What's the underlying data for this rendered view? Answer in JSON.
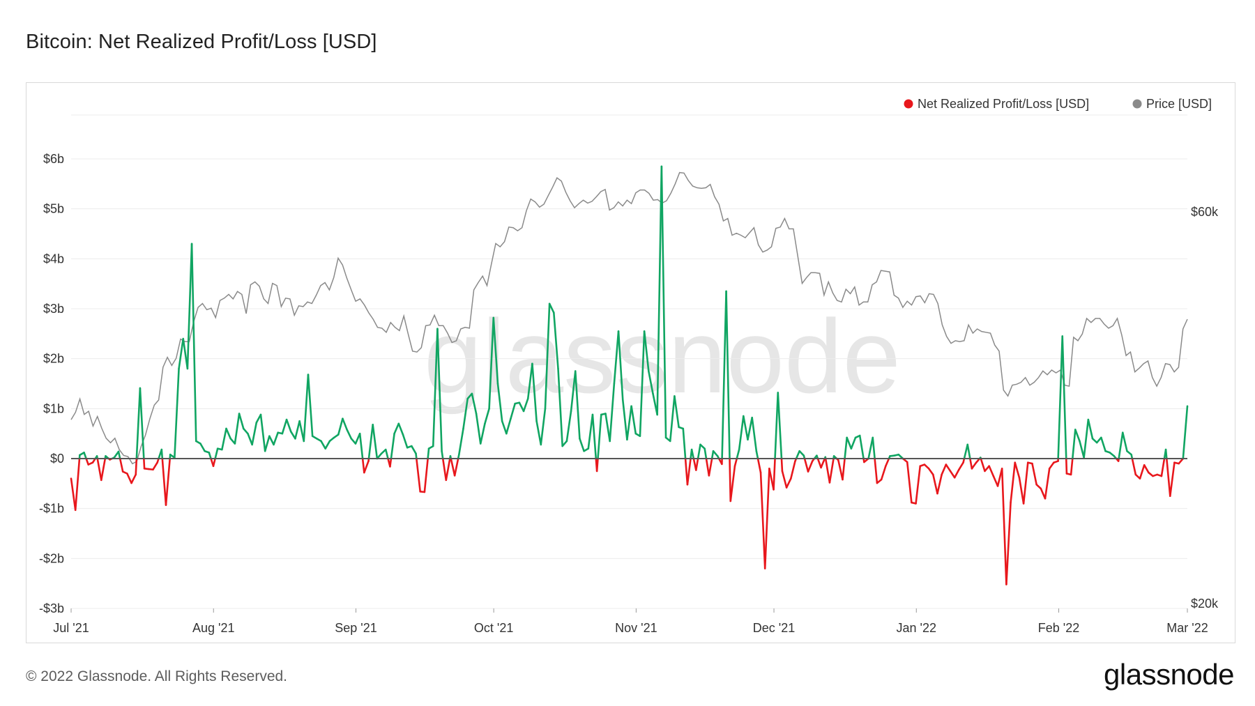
{
  "header": {
    "title": "Bitcoin: Net Realized Profit/Loss [USD]"
  },
  "footer": {
    "copyright": "© 2022 Glassnode. All Rights Reserved.",
    "brand": "glassnode"
  },
  "watermark": "glassnode",
  "colors": {
    "profit": "#10a562",
    "loss": "#e8171c",
    "price": "#8a8a8a",
    "zero": "#555555",
    "grid": "#ececec"
  },
  "chart_data": {
    "type": "line",
    "title": "Bitcoin: Net Realized Profit/Loss [USD]",
    "legend": {
      "placement": "top-right",
      "items": [
        {
          "label": "Net Realized Profit/Loss [USD]",
          "color": "#e8171c"
        },
        {
          "label": "Price [USD]",
          "color": "#8a8a8a"
        }
      ]
    },
    "x_ticks": [
      "Jul '21",
      "Aug '21",
      "Sep '21",
      "Oct '21",
      "Nov '21",
      "Dec '21",
      "Jan '22",
      "Feb '22",
      "Mar '22"
    ],
    "x_range": [
      "2021-07-01",
      "2022-03-01"
    ],
    "y_left": {
      "ticks": [
        "$6b",
        "$5b",
        "$4b",
        "$3b",
        "$2b",
        "$1b",
        "$0",
        "-$1b",
        "-$2b",
        "-$3b"
      ],
      "min": -3,
      "max": 6,
      "unit": "billion USD"
    },
    "y_right": {
      "ticks": [
        "$60k",
        "$20k"
      ],
      "min": 20000,
      "max": 60000,
      "scale": "log"
    },
    "grid": true,
    "series": [
      {
        "name": "Net Realized Profit/Loss [USD]",
        "unit": "billion USD",
        "values": [
          -0.4,
          -1.03,
          0.07,
          0.12,
          -0.12,
          -0.08,
          0.05,
          -0.43,
          0.05,
          -0.02,
          0.02,
          0.14,
          -0.26,
          -0.3,
          -0.49,
          -0.32,
          1.41,
          -0.2,
          -0.21,
          -0.22,
          -0.08,
          0.18,
          -0.93,
          0.08,
          0.02,
          1.8,
          2.4,
          1.8,
          4.3,
          0.35,
          0.3,
          0.15,
          0.12,
          -0.15,
          0.2,
          0.18,
          0.6,
          0.4,
          0.3,
          0.9,
          0.6,
          0.5,
          0.28,
          0.72,
          0.88,
          0.15,
          0.45,
          0.28,
          0.52,
          0.5,
          0.78,
          0.54,
          0.4,
          0.75,
          0.35,
          1.68,
          0.45,
          0.4,
          0.35,
          0.2,
          0.35,
          0.42,
          0.48,
          0.8,
          0.58,
          0.4,
          0.3,
          0.5,
          -0.28,
          -0.05,
          0.68,
          0.0,
          0.1,
          0.18,
          -0.16,
          0.5,
          0.7,
          0.48,
          0.22,
          0.25,
          0.1,
          -0.66,
          -0.67,
          0.2,
          0.25,
          2.6,
          0.15,
          -0.43,
          0.05,
          -0.34,
          0.08,
          0.6,
          1.2,
          1.3,
          0.9,
          0.3,
          0.7,
          1.0,
          2.82,
          1.5,
          0.75,
          0.5,
          0.8,
          1.1,
          1.12,
          0.95,
          1.2,
          1.9,
          0.75,
          0.28,
          1.0,
          3.1,
          2.92,
          1.8,
          0.25,
          0.35,
          0.95,
          1.75,
          0.4,
          0.15,
          0.2,
          0.88,
          -0.25,
          0.88,
          0.9,
          0.35,
          1.5,
          2.55,
          1.18,
          0.38,
          1.05,
          0.5,
          0.45,
          2.55,
          1.75,
          1.3,
          0.88,
          5.85,
          0.42,
          0.35,
          1.25,
          0.63,
          0.6,
          -0.52,
          0.18,
          -0.23,
          0.28,
          0.2,
          -0.34,
          0.15,
          0.05,
          -0.11,
          3.35,
          -0.85,
          -0.15,
          0.18,
          0.85,
          0.38,
          0.82,
          0.15,
          -0.28,
          -2.2,
          -0.2,
          -0.62,
          1.32,
          -0.25,
          -0.58,
          -0.4,
          -0.05,
          0.15,
          0.06,
          -0.26,
          -0.05,
          0.06,
          -0.18,
          0.03,
          -0.48,
          0.05,
          -0.03,
          -0.42,
          0.42,
          0.2,
          0.42,
          0.46,
          -0.07,
          0.0,
          0.42,
          -0.49,
          -0.42,
          -0.15,
          0.05,
          0.06,
          0.08,
          0.0,
          -0.07,
          -0.88,
          -0.9,
          -0.15,
          -0.12,
          -0.2,
          -0.32,
          -0.7,
          -0.32,
          -0.12,
          -0.25,
          -0.38,
          -0.22,
          -0.08,
          0.28,
          -0.2,
          -0.08,
          0.02,
          -0.25,
          -0.15,
          -0.35,
          -0.55,
          -0.2,
          -2.52,
          -0.88,
          -0.08,
          -0.38,
          -0.9,
          -0.08,
          -0.1,
          -0.52,
          -0.6,
          -0.8,
          -0.2,
          -0.08,
          -0.05,
          2.45,
          -0.3,
          -0.32,
          0.58,
          0.35,
          0.02,
          0.78,
          0.4,
          0.32,
          0.42,
          0.15,
          0.12,
          0.05,
          -0.05,
          0.52,
          0.15,
          0.08,
          -0.32,
          -0.4,
          -0.13,
          -0.28,
          -0.35,
          -0.32,
          -0.35,
          0.18,
          -0.75,
          -0.08,
          -0.1,
          0.0,
          1.05
        ]
      },
      {
        "name": "Price [USD]",
        "unit": "USD",
        "values": [
          33500,
          34200,
          35500,
          34000,
          34300,
          32900,
          33800,
          32700,
          31800,
          31400,
          31800,
          30800,
          30300,
          30200,
          29600,
          29800,
          31100,
          32100,
          33600,
          34900,
          35400,
          38800,
          39900,
          39000,
          39800,
          42000,
          41700,
          41700,
          44100,
          45900,
          46400,
          45600,
          45800,
          44600,
          46800,
          47100,
          47600,
          47000,
          48000,
          47600,
          45100,
          48900,
          49300,
          48700,
          47000,
          46400,
          49100,
          48800,
          46000,
          47100,
          47000,
          44900,
          46100,
          46000,
          46600,
          46400,
          47500,
          48800,
          49200,
          48200,
          49900,
          52700,
          51700,
          49800,
          48200,
          46700,
          47000,
          46200,
          45200,
          44400,
          43400,
          43300,
          42800,
          44000,
          43400,
          43000,
          44800,
          42600,
          40600,
          40500,
          41000,
          43600,
          43700,
          44900,
          43600,
          43600,
          42700,
          41600,
          41800,
          43200,
          43400,
          43300,
          48200,
          49200,
          50100,
          48800,
          51800,
          54900,
          54400,
          55200,
          57500,
          57400,
          56900,
          57400,
          60200,
          62200,
          61700,
          60800,
          61300,
          62800,
          64300,
          66000,
          65400,
          63400,
          61900,
          60700,
          61400,
          62000,
          61500,
          61800,
          62600,
          63500,
          63900,
          60300,
          60700,
          61700,
          61000,
          62000,
          61400,
          63300,
          63800,
          63800,
          63200,
          62000,
          62100,
          61500,
          61900,
          63200,
          64900,
          67000,
          66900,
          65500,
          64500,
          64200,
          64100,
          64200,
          64800,
          62600,
          61300,
          58500,
          58900,
          56200,
          56500,
          56200,
          55800,
          56600,
          57400,
          54700,
          53600,
          53900,
          54400,
          57300,
          57500,
          58900,
          57200,
          57200,
          53000,
          49100,
          49900,
          50600,
          50600,
          50500,
          47500,
          49300,
          47800,
          46800,
          46600,
          48300,
          47700,
          48600,
          46200,
          46600,
          46600,
          48900,
          49300,
          50900,
          50800,
          50700,
          47500,
          47100,
          45900,
          46700,
          46200,
          47300,
          47400,
          46500,
          47700,
          47600,
          46400,
          43700,
          42300,
          41500,
          41800,
          41700,
          41800,
          43700,
          42700,
          43200,
          42900,
          42800,
          42700,
          41300,
          40600,
          36400,
          35800,
          36900,
          37000,
          37200,
          37700,
          36900,
          37200,
          37700,
          38400,
          38000,
          38500,
          38200,
          38500,
          36900,
          36800,
          42200,
          41800,
          42600,
          44500,
          44000,
          44500,
          44500,
          43800,
          43300,
          43600,
          44500,
          42500,
          40100,
          40500,
          38300,
          38700,
          39200,
          39500,
          37700,
          36800,
          37700,
          39200,
          39100,
          38300,
          38800,
          43200,
          44400
        ]
      }
    ]
  }
}
